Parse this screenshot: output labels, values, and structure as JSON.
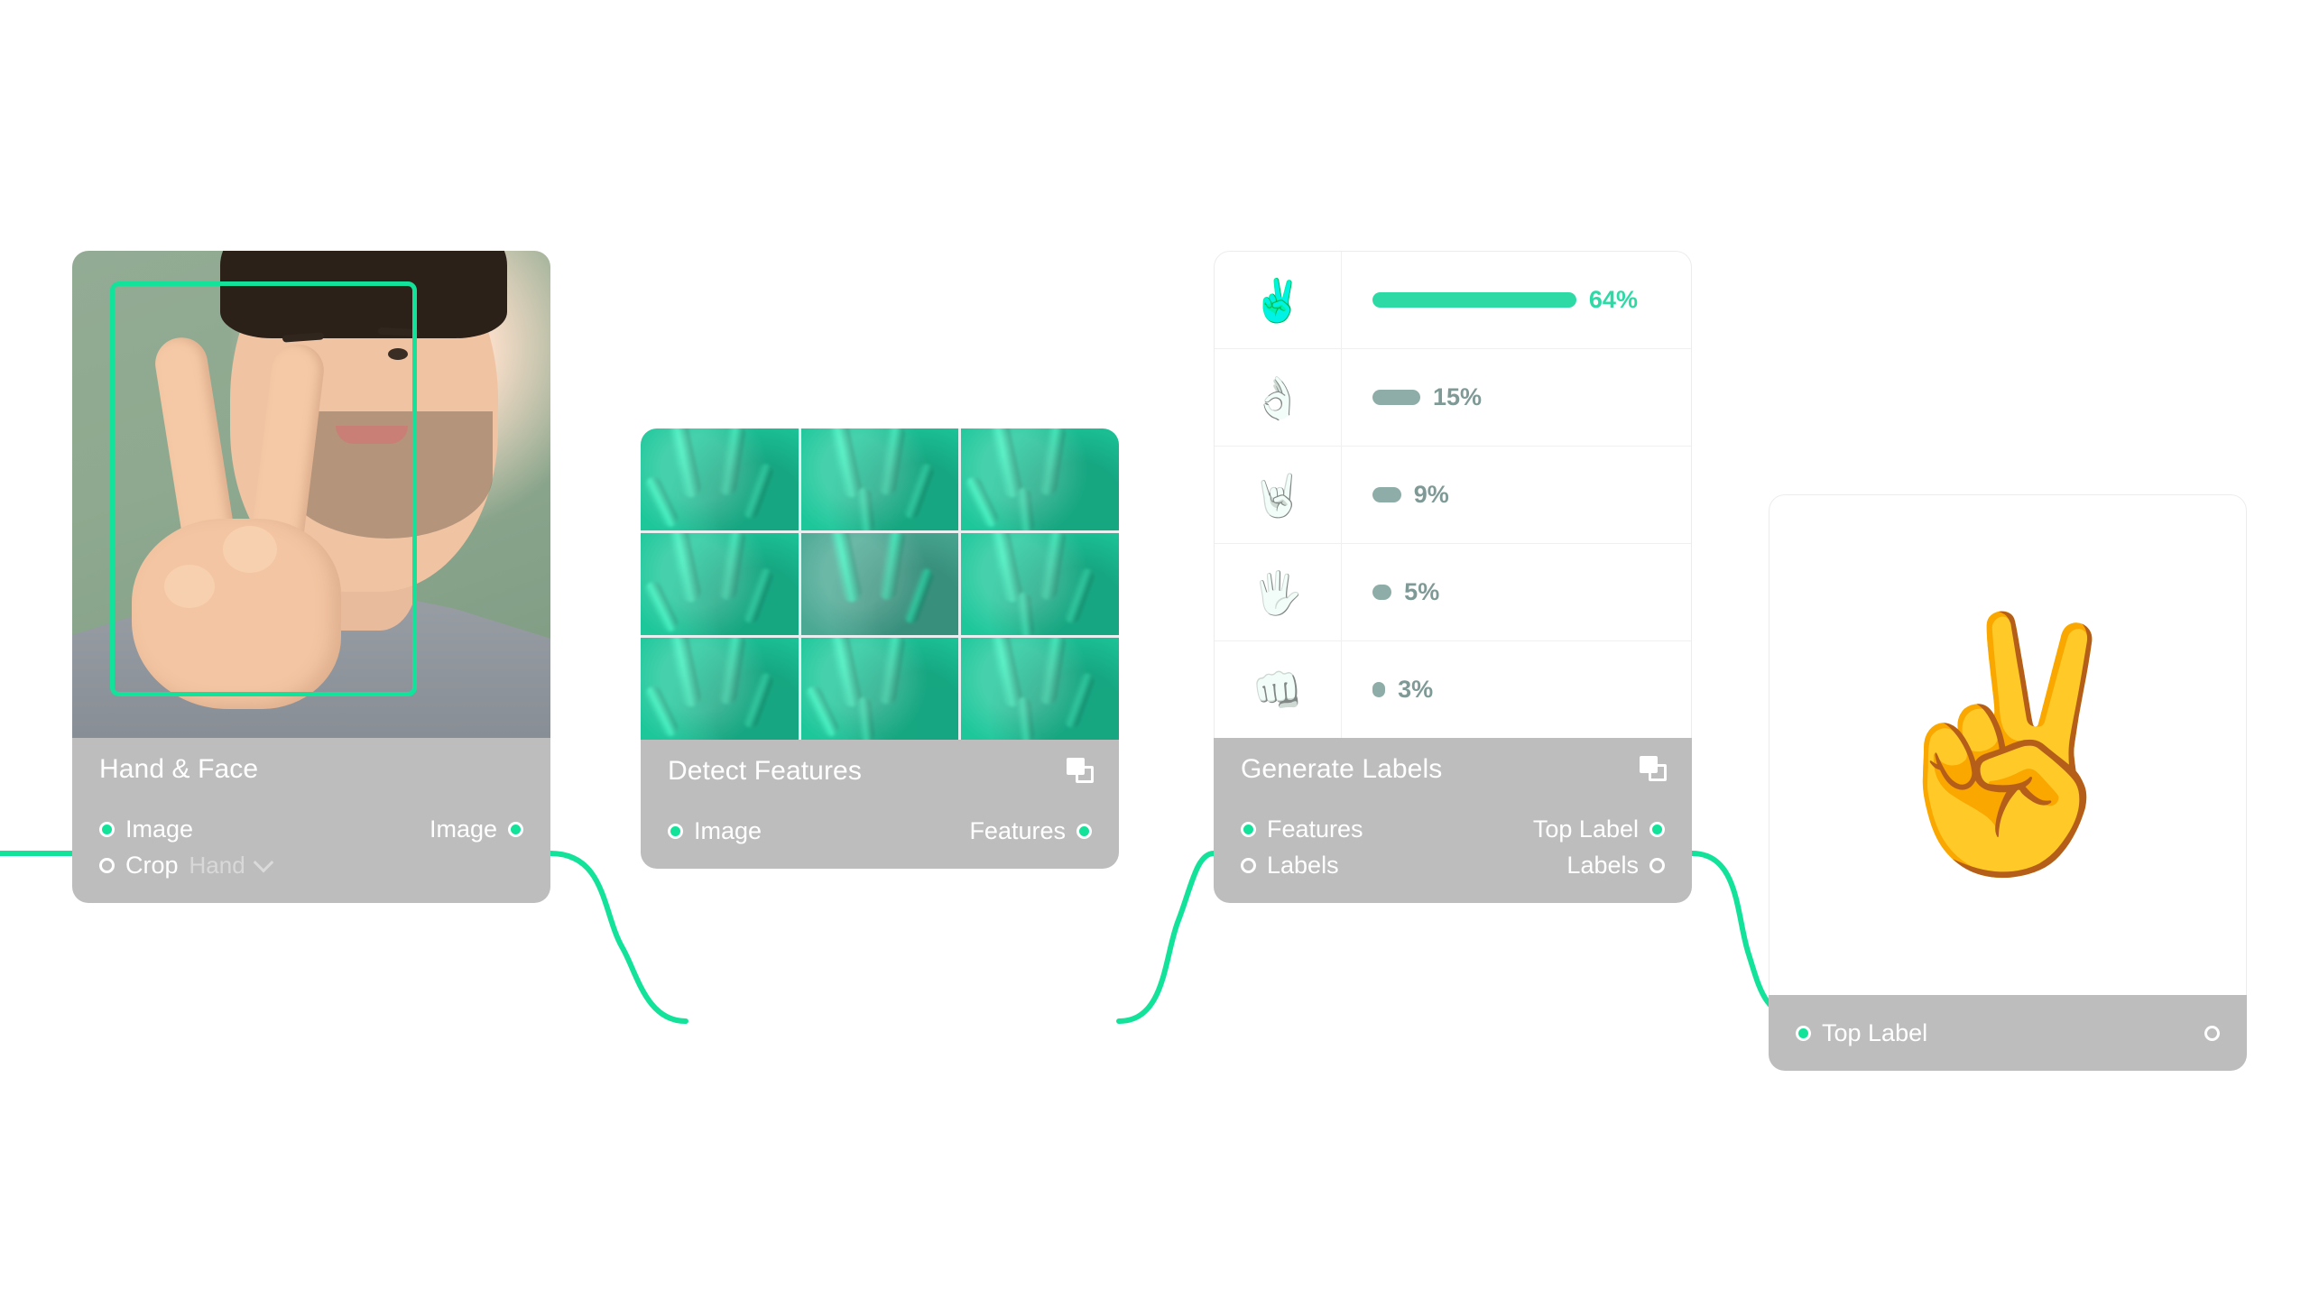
{
  "canvas": {
    "background": "#ffffff",
    "accent": "#12e29a",
    "node_footer_color": "#bdbdbd"
  },
  "nodes": [
    {
      "id": "hand-face",
      "title": "Hand & Face",
      "has_duplicate_icon": false,
      "inputs": [
        {
          "label": "Image",
          "connected": true
        },
        {
          "label": "Crop",
          "connected": false,
          "value": "Hand",
          "control": "dropdown"
        }
      ],
      "outputs": [
        {
          "label": "Image",
          "connected": true
        }
      ],
      "preview": {
        "type": "photo",
        "description": "person making peace sign with green detection bounding box over the hand"
      }
    },
    {
      "id": "detect-features",
      "title": "Detect Features",
      "has_duplicate_icon": true,
      "inputs": [
        {
          "label": "Image",
          "connected": true
        }
      ],
      "outputs": [
        {
          "label": "Features",
          "connected": true
        }
      ],
      "preview": {
        "type": "feature-map-grid",
        "rows": 3,
        "cols": 3
      }
    },
    {
      "id": "generate-labels",
      "title": "Generate Labels",
      "has_duplicate_icon": true,
      "inputs": [
        {
          "label": "Features",
          "connected": true
        },
        {
          "label": "Labels",
          "connected": false
        }
      ],
      "outputs": [
        {
          "label": "Top Label",
          "connected": true
        },
        {
          "label": "Labels",
          "connected": false
        }
      ],
      "preview": {
        "type": "label-ranking"
      }
    },
    {
      "id": "top-label",
      "title": "",
      "has_duplicate_icon": false,
      "inputs": [
        {
          "label": "Top Label",
          "connected": true
        }
      ],
      "outputs": [
        {
          "label": "",
          "connected": false
        }
      ],
      "preview": {
        "type": "emoji-result",
        "emoji": "✌️"
      }
    }
  ],
  "chart_data": {
    "type": "bar",
    "title": "Generate Labels",
    "xlabel": "",
    "ylabel": "",
    "categories": [
      "✌️",
      "👌",
      "🤘",
      "🖐️",
      "👊"
    ],
    "values": [
      64,
      15,
      9,
      5,
      3
    ],
    "value_labels": [
      "64%",
      "15%",
      "9%",
      "5%",
      "3%"
    ],
    "xlim": [
      0,
      100
    ],
    "grid": false,
    "legend": "none",
    "highlight_index": 0,
    "highlight_color": "#2ddaa5",
    "bar_color": "#8fada8"
  },
  "connections": [
    {
      "from": "offscreen-left",
      "to": "hand-face.Image"
    },
    {
      "from": "hand-face.Image",
      "to": "detect-features.Image"
    },
    {
      "from": "detect-features.Features",
      "to": "generate-labels.Features"
    },
    {
      "from": "generate-labels.Top Label",
      "to": "top-label.Top Label"
    }
  ]
}
